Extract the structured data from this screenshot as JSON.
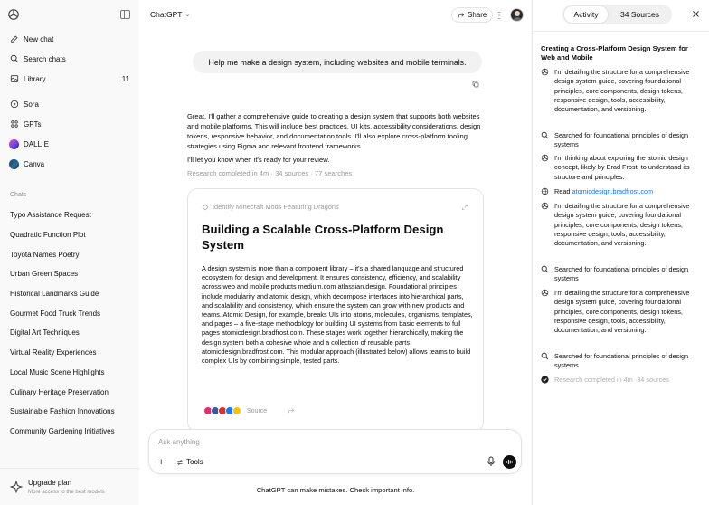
{
  "sidebar": {
    "nav": [
      {
        "label": "New chat",
        "icon": "edit-icon"
      },
      {
        "label": "Search chats",
        "icon": "search-icon"
      },
      {
        "label": "Library",
        "icon": "library-icon",
        "count": "11"
      },
      {
        "label": "Sora",
        "icon": "play-icon"
      },
      {
        "label": "GPTs",
        "icon": "grid-icon"
      },
      {
        "label": "DALL·E",
        "icon": "dalle-avatar"
      },
      {
        "label": "Canva",
        "icon": "canva-avatar"
      }
    ],
    "section_label": "Chats",
    "chats": [
      "Typo Assistance Request",
      "Quadratic Function Plot",
      "Toyota Names Poetry",
      "Urban Green Spaces",
      "Historical Landmarks Guide",
      "Gourmet Food Truck Trends",
      "Digital Art Techniques",
      "Virtual Reality Experiences",
      "Local Music Scene Highlights",
      "Culinary Heritage Preservation",
      "Sustainable Fashion Innovations",
      "Community Gardening Initiatives"
    ],
    "upgrade": {
      "title": "Upgrade plan",
      "subtitle": "More access to the best models"
    }
  },
  "header": {
    "model": "ChatGPT",
    "share": "Share"
  },
  "conversation": {
    "user_message": "Help me make a design system, including websites and mobile terminals.",
    "assistant_intro": "Great. I'll gather a comprehensive guide to creating a design system that supports both websites and mobile platforms. This will include best practices, UI kits, accessibility considerations, design tokens, responsive behavior, and documentation tools. I'll also explore cross-platform tooling strategies using Figma and relevant frontend frameworks.",
    "assistant_followup": "I'll let you know when it's ready for your review.",
    "research_meta": "Research completed in 4m · 34 sources · 77 searches",
    "report": {
      "header": "Identify Minecraft Mods Featuring Dragons",
      "title": "Building a Scalable Cross-Platform Design System",
      "body": "A design system is more than a component library – it's a shared language and structured ecosystem for design and development. It ensures consistency, efficiency, and scalability across web and mobile products medium.com atlassian.design. Foundational principles include modularity and atomic design, which decompose interfaces into hierarchical parts, and scalability and consistency, which ensure the system can grow with new products and teams. Atomic Design, for example, breaks UIs into atoms, molecules, organisms, templates, and pages – a five-stage methodology for building UI systems from basic elements to full pages atomicdesign.bradfrost.com. These stages work together hierarchically, making the design system both a cohesive whole and a collection of reusable parts atomicdesign.bradfrost.com. This modular approach (illustrated below) allows teams to build complex UIs by combining simple, tested parts.",
      "sources_label": "Source",
      "source_colors": [
        "#e1306c",
        "#3b5998",
        "#d93025",
        "#1877f2",
        "#f4c20d"
      ]
    }
  },
  "composer": {
    "placeholder": "Ask anything",
    "tools": "Tools"
  },
  "disclaimer": "ChatGPT can make mistakes. Check important info.",
  "panel": {
    "tabs": [
      "Activity",
      "34 Sources"
    ],
    "title": "Creating a Cross-Platform Design System for Web and Mobile",
    "items": [
      {
        "icon": "openai-icon",
        "text": "I'm detailing the structure for a comprehensive design system guide, covering foundational principles, core components, design tokens, responsive design, tools, accessibility, documentation, and versioning."
      },
      {
        "icon": "search-icon",
        "text": "Searched for foundational principles of design systems"
      },
      {
        "icon": "openai-icon",
        "text": "I'm thinking about exploring the atomic design concept, likely by Brad Frost, to understand its structure and principles."
      },
      {
        "icon": "globe-icon",
        "text_prefix": "Read ",
        "link": "atomicdesign.bradfrost.com"
      },
      {
        "icon": "openai-icon",
        "text": "I'm detailing the structure for a comprehensive design system guide, covering foundational principles, core components, design tokens, responsive design, tools, accessibility, documentation, and versioning."
      },
      {
        "icon": "search-icon",
        "text": "Searched for foundational principles of design systems"
      },
      {
        "icon": "openai-icon",
        "text": "I'm detailing the structure for a comprehensive design system guide, covering foundational principles, core components, design tokens, responsive design, tools, accessibility, documentation, and versioning."
      },
      {
        "icon": "search-icon",
        "text": "Searched for foundational principles of design systems"
      },
      {
        "icon": "check-icon",
        "text": "Research completed in 4m ·34 sources"
      }
    ]
  }
}
